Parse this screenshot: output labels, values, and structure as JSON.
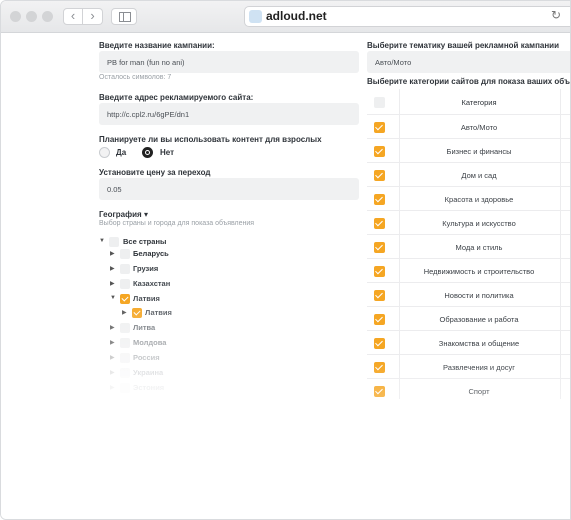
{
  "browser": {
    "url": "adloud.net"
  },
  "form": {
    "campaign_name_label": "Введите название кампании:",
    "campaign_name_value": "PB for man (fun no ani)",
    "chars_left": "Осталось символов: 7",
    "site_label": "Введите адрес рекламируемого сайта:",
    "site_value": "http://c.cpl2.ru/6gPE/dn1",
    "adult_label": "Планируете ли вы использовать контент для взрослых",
    "adult_yes": "Да",
    "adult_no": "Нет",
    "price_label": "Установите цену за переход",
    "price_value": "0.05"
  },
  "geo": {
    "title": "География ▾",
    "subtitle": "Выбор страны и города для показа объявления",
    "all": "Все страны",
    "items": [
      "Беларусь",
      "Грузия",
      "Казахстан",
      "Латвия",
      "Латвия",
      "Литва",
      "Молдова",
      "Россия",
      "Украина",
      "Эстония"
    ]
  },
  "topic": {
    "label": "Выберите тематику вашей рекламной кампании",
    "value": "Авто/Мото"
  },
  "categories": {
    "label": "Выберите категории сайтов для показа ваших объявлений",
    "header": "Категория",
    "items": [
      "Авто/Мото",
      "Бизнес и финансы",
      "Дом и сад",
      "Красота и здоровье",
      "Культура и искусство",
      "Мода и стиль",
      "Недвижимость и строительство",
      "Новости и политика",
      "Образование и работа",
      "Знакомства и общение",
      "Развлечения и досуг",
      "Спорт"
    ]
  },
  "colors": {
    "accent": "#f5a623",
    "field_bg": "#f0f1f2"
  }
}
